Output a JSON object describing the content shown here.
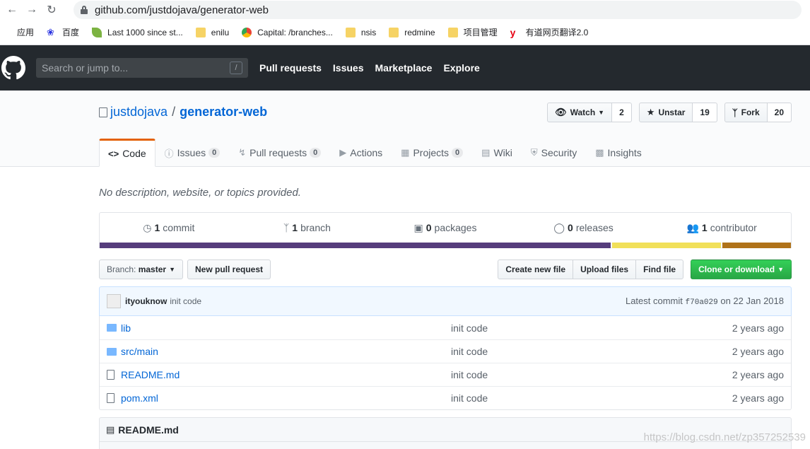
{
  "browser": {
    "url": "github.com/justdojava/generator-web",
    "bookmarks": [
      {
        "label": "应用",
        "icon": "apps-icon"
      },
      {
        "label": "百度",
        "icon": "baidu-icon"
      },
      {
        "label": "Last 1000 since st...",
        "icon": "leaf-icon"
      },
      {
        "label": "enilu",
        "icon": "folder-icon"
      },
      {
        "label": "Capital: /branches...",
        "icon": "chrome-icon"
      },
      {
        "label": "nsis",
        "icon": "folder-icon"
      },
      {
        "label": "redmine",
        "icon": "folder-icon"
      },
      {
        "label": "项目管理",
        "icon": "folder-icon"
      },
      {
        "label": "有道网页翻译2.0",
        "icon": "youdao-icon"
      }
    ]
  },
  "header": {
    "search_placeholder": "Search or jump to...",
    "search_key": "/",
    "nav": [
      "Pull requests",
      "Issues",
      "Marketplace",
      "Explore"
    ]
  },
  "repo": {
    "owner": "justdojava",
    "separator": "/",
    "name": "generator-web",
    "watch_label": "Watch",
    "watch_count": "2",
    "star_label": "Unstar",
    "star_count": "19",
    "fork_label": "Fork",
    "fork_count": "20",
    "tabs": [
      {
        "label": "Code",
        "counter": ""
      },
      {
        "label": "Issues",
        "counter": "0"
      },
      {
        "label": "Pull requests",
        "counter": "0"
      },
      {
        "label": "Actions",
        "counter": ""
      },
      {
        "label": "Projects",
        "counter": "0"
      },
      {
        "label": "Wiki",
        "counter": ""
      },
      {
        "label": "Security",
        "counter": ""
      },
      {
        "label": "Insights",
        "counter": ""
      }
    ],
    "description": "No description, website, or topics provided."
  },
  "summary": {
    "commits_num": "1",
    "commits_label": "commit",
    "branches_num": "1",
    "branches_label": "branch",
    "packages_num": "0",
    "packages_label": "packages",
    "releases_num": "0",
    "releases_label": "releases",
    "contributors_num": "1",
    "contributors_label": "contributor",
    "languages": [
      {
        "color": "#563d7c",
        "percent": 74.2
      },
      {
        "color": "#f1e05a",
        "percent": 15.8
      },
      {
        "color": "#b07219",
        "percent": 10.0
      }
    ]
  },
  "file_nav": {
    "branch_prefix": "Branch:",
    "branch_name": "master",
    "new_pr": "New pull request",
    "create_file": "Create new file",
    "upload_files": "Upload files",
    "find_file": "Find file",
    "clone": "Clone or download"
  },
  "commit": {
    "author": "ityouknow",
    "message": "init code",
    "latest_label": "Latest commit",
    "sha": "f70a029",
    "date": "on 22 Jan 2018"
  },
  "files": [
    {
      "name": "lib",
      "type": "dir",
      "message": "init code",
      "age": "2 years ago"
    },
    {
      "name": "src/main",
      "type": "dir",
      "message": "init code",
      "age": "2 years ago"
    },
    {
      "name": "README.md",
      "type": "file",
      "message": "init code",
      "age": "2 years ago"
    },
    {
      "name": "pom.xml",
      "type": "file",
      "message": "init code",
      "age": "2 years ago"
    }
  ],
  "readme_title": "README.md",
  "watermark": "https://blog.csdn.net/zp357252539"
}
